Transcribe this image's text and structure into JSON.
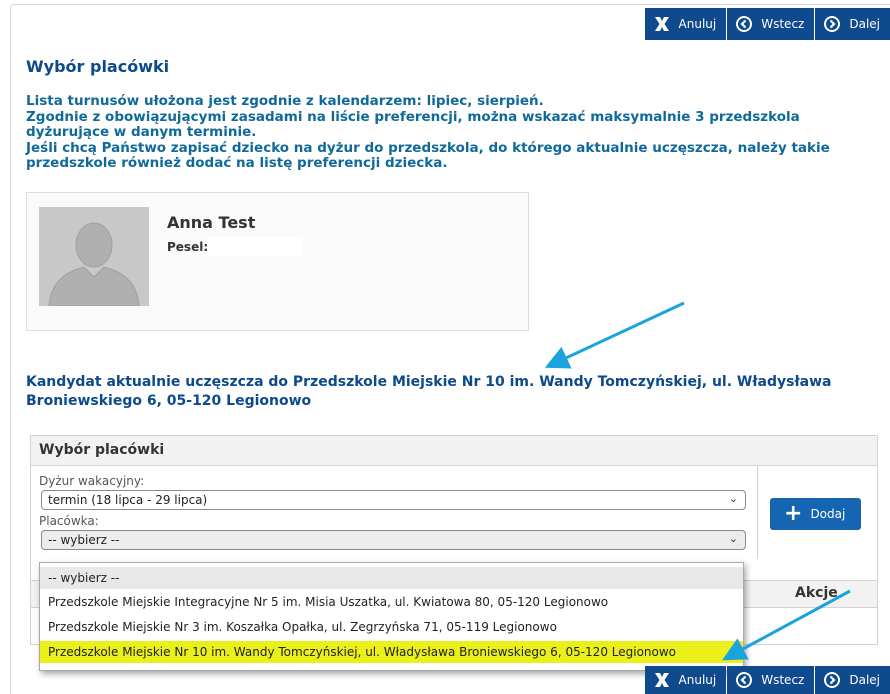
{
  "toolbar": {
    "cancel_label": "Anuluj",
    "back_label": "Wstecz",
    "next_label": "Dalej"
  },
  "page": {
    "title": "Wybór placówki",
    "info_lines": [
      "Lista turnusów ułożona jest zgodnie z kalendarzem: lipiec, sierpień.",
      "Zgodnie z obowiązującymi zasadami na liście preferencji, można wskazać maksymalnie 3 przedszkola dyżurujące w danym terminie.",
      "Jeśli chcą Państwo zapisać dziecko na dyżur do przedszkola, do którego aktualnie uczęszcza, należy takie przedszkole również dodać na listę preferencji dziecka."
    ]
  },
  "candidate": {
    "name": "Anna Test",
    "pesel_label": "Pesel:",
    "current_school": "Kandydat aktualnie uczęszcza do Przedszkole Miejskie Nr 10 im. Wandy Tomczyńskiej, ul. Władysława Broniewskiego 6, 05-120 Legionowo"
  },
  "panel": {
    "title": "Wybór placówki",
    "duty_label": "Dyżur wakacyjny:",
    "duty_value": "termin (18 lipca - 29 lipca)",
    "facility_label": "Placówka:",
    "facility_value": "-- wybierz --",
    "add_label": "Dodaj",
    "actions_header": "Akcje"
  },
  "dropdown": {
    "options": [
      "-- wybierz --",
      "Przedszkole Miejskie Integracyjne Nr 5 im. Misia Uszatka, ul. Kwiatowa 80, 05-120 Legionowo",
      "Przedszkole Miejskie Nr 3 im. Koszałka Opałka, ul. Zegrzyńska 71, 05-119 Legionowo",
      "Przedszkole Miejskie Nr 10 im. Wandy Tomczyńskiej, ul. Władysława Broniewskiego 6, 05-120 Legionowo"
    ],
    "highlighted_index": 3
  },
  "colors": {
    "primary": "#104a8e",
    "title": "#0d4a8c",
    "info": "#0f6a9a",
    "highlight": "#ebf01a",
    "annotation_arrow": "#1aa3dd"
  }
}
